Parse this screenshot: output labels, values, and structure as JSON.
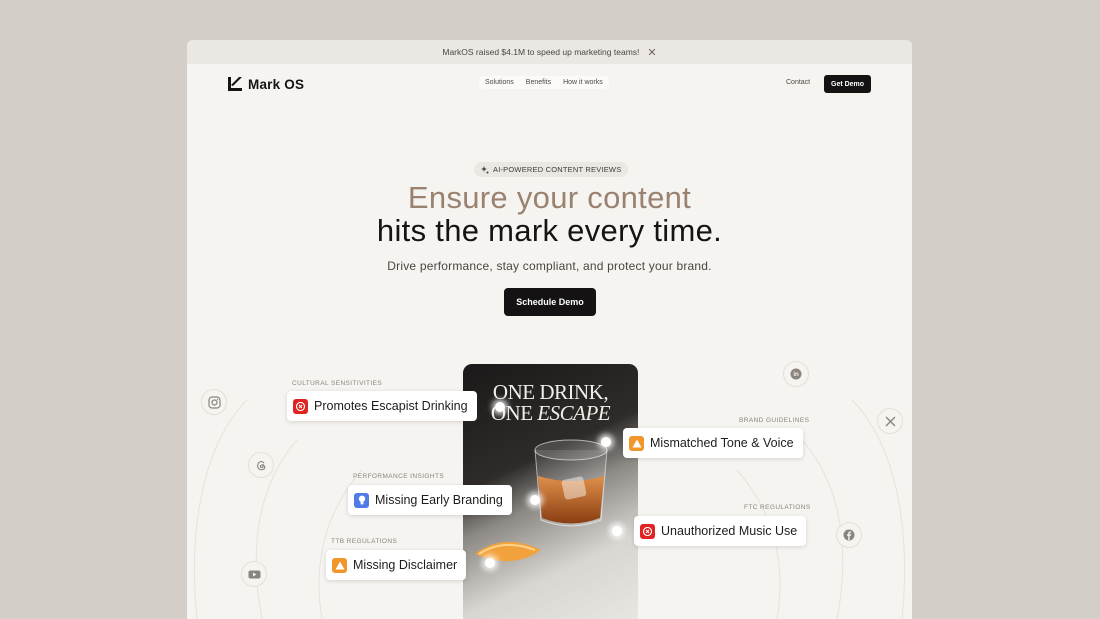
{
  "announcement": {
    "text": "MarkOS raised $4.1M to speed up marketing teams!",
    "close_glyph": "✕"
  },
  "nav": {
    "logo_text": "Mark OS",
    "links": [
      "Solutions",
      "Benefits",
      "How it works"
    ],
    "contact_label": "Contact",
    "demo_label": "Get Demo"
  },
  "hero": {
    "badge": "AI-POWERED CONTENT REVIEWS",
    "line1": "Ensure your content",
    "line2": "hits the mark every time.",
    "subline": "Drive performance, stay compliant, and protect your brand.",
    "cta_label": "Schedule Demo"
  },
  "phone": {
    "title_line1": "ONE DRINK,",
    "title_line2_prefix": "ONE ",
    "title_line2_italic": "ESCAPE"
  },
  "tags": [
    {
      "category": "CULTURAL SENSITIVITIES",
      "text": "Promotes Escapist Drinking",
      "icon": "x-octagon-icon",
      "color": "#e02424"
    },
    {
      "category": "BRAND GUIDELINES",
      "text": "Mismatched Tone & Voice",
      "icon": "warning-icon",
      "color": "#f0962a"
    },
    {
      "category": "PERFORMANCE INSIGHTS",
      "text": "Missing Early Branding",
      "icon": "lightbulb-icon",
      "color": "#4f7ae8"
    },
    {
      "category": "FTC REGULATIONS",
      "text": "Unauthorized Music Use",
      "icon": "x-octagon-icon",
      "color": "#e02424"
    },
    {
      "category": "TTB REGULATIONS",
      "text": "Missing Disclaimer",
      "icon": "warning-icon",
      "color": "#f0962a"
    }
  ],
  "socials": [
    "instagram-icon",
    "threads-icon",
    "youtube-icon",
    "linkedin-icon",
    "x-icon",
    "facebook-icon"
  ],
  "colors": {
    "accent_text": "#9a8270",
    "button_bg": "#141212",
    "page_bg": "#f6f4f1"
  }
}
